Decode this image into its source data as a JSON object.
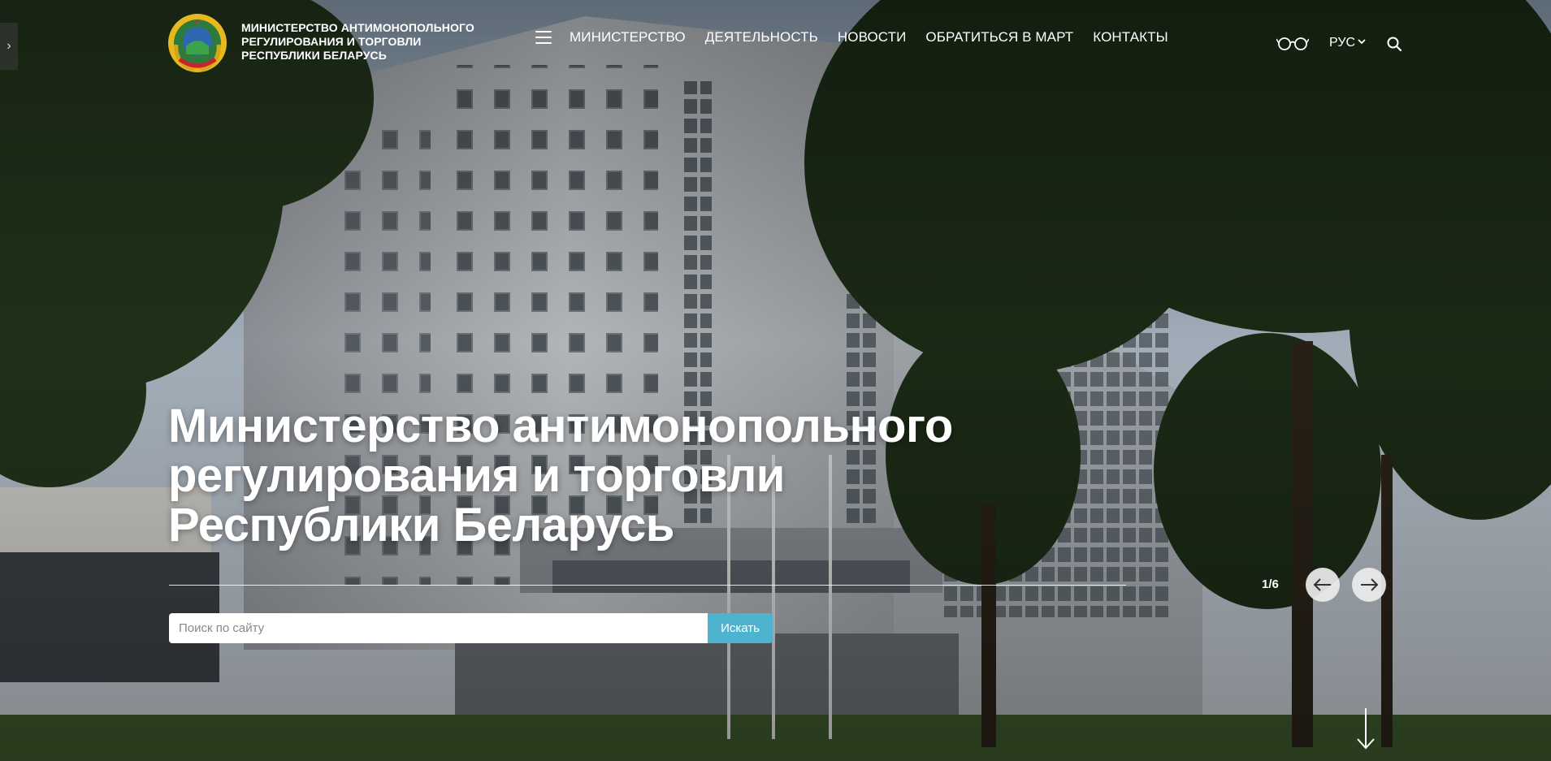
{
  "header": {
    "ministry_name_lines": [
      "МИНИСТЕРСТВО АНТИМОНОПОЛЬНОГО",
      "РЕГУЛИРОВАНИЯ И ТОРГОВЛИ",
      "РЕСПУБЛИКИ БЕЛАРУСЬ"
    ],
    "nav": [
      {
        "label": "МИНИСТЕРСТВО"
      },
      {
        "label": "ДЕЯТЕЛЬНОСТЬ"
      },
      {
        "label": "НОВОСТИ"
      },
      {
        "label": "ОБРАТИТЬСЯ В МАРТ"
      },
      {
        "label": "КОНТАКТЫ"
      }
    ],
    "language": "РУС",
    "icons": {
      "menu": "hamburger-menu-icon",
      "accessibility": "glasses-icon",
      "search": "search-icon",
      "language_toggle": "chevron-down-icon",
      "sidebar": "chevron-right-icon"
    }
  },
  "hero": {
    "title_lines": [
      "Министерство антимонопольного",
      "регулирования и торговли",
      "Республики Беларусь"
    ],
    "slide_counter": "1/6",
    "search": {
      "placeholder": "Поиск по сайту",
      "button_label": "Искать"
    }
  },
  "colors": {
    "accent": "#4eb3cf",
    "text": "#ffffff",
    "arrow_button_bg": "#ebebeb"
  }
}
